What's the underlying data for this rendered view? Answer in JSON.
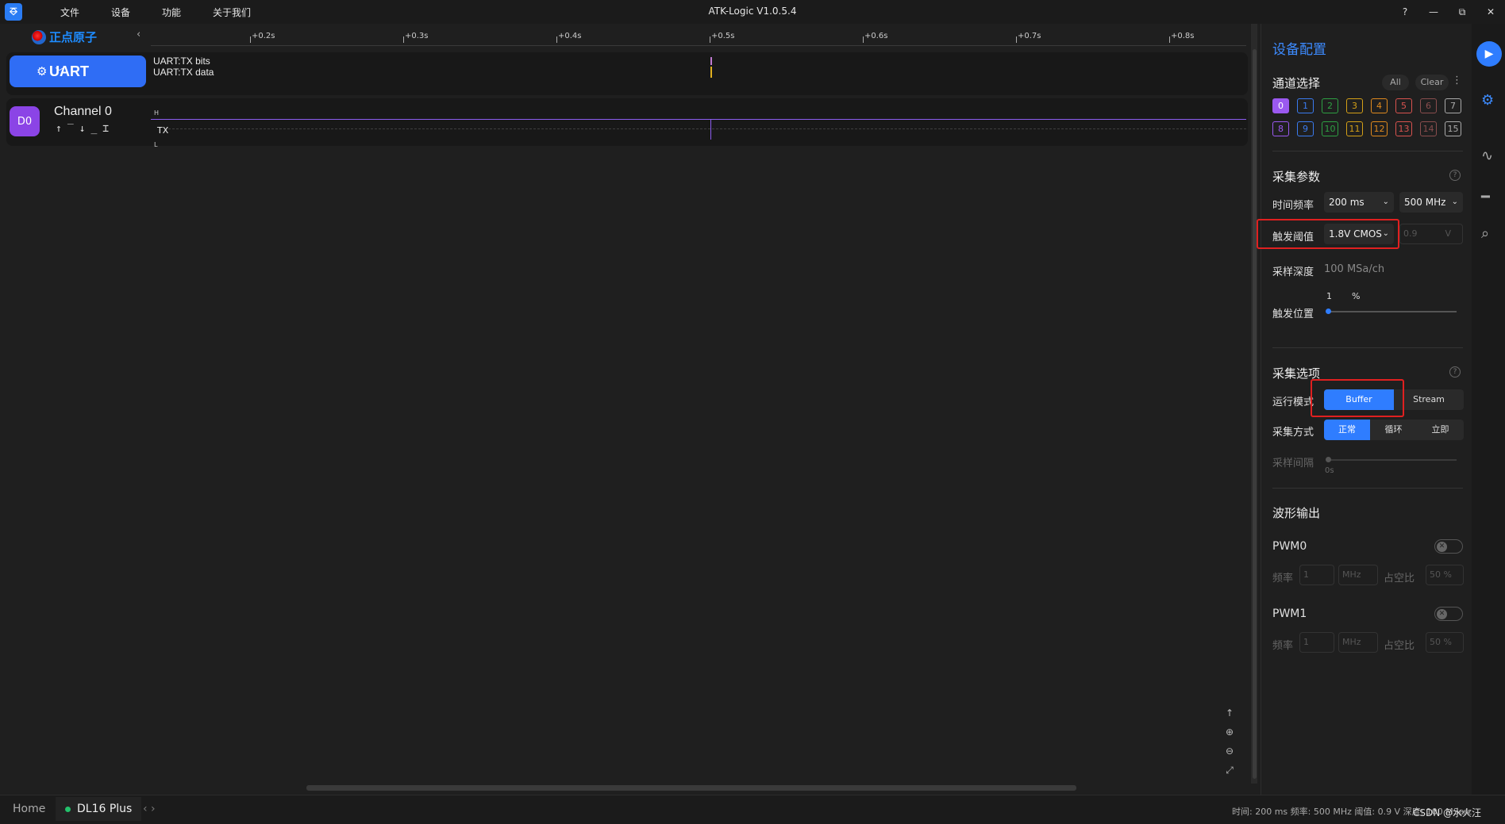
{
  "app": {
    "logo_glyph": "⎑",
    "title": "ATK-Logic  V1.0.5.4"
  },
  "menu": [
    "文件",
    "设备",
    "功能",
    "关于我们"
  ],
  "window_controls": [
    "?",
    "—",
    "⧉",
    "✕"
  ],
  "brand": {
    "text": "正点原子",
    "collapse_glyph": "‹"
  },
  "ruler": {
    "ticks": [
      "+0.2s",
      "+0.3s",
      "+0.4s",
      "+0.5s",
      "+0.6s",
      "+0.7s",
      "+0.8s"
    ]
  },
  "decoder": {
    "name": "UART",
    "gear": "⚙",
    "chevron": "﹀",
    "line1": "UART:TX bits",
    "line2": "UART:TX data"
  },
  "channel": {
    "badge": "D0",
    "name": "Channel 0",
    "trigger_icons": "↑‾↓_⌶",
    "high": "H",
    "low": "L",
    "signal": "TX"
  },
  "zoom_tools": [
    "↑",
    "⊕",
    "⊖",
    "⤢"
  ],
  "panel": {
    "title": "设备配置",
    "channels": {
      "title": "通道选择",
      "all": "All",
      "clear": "Clear",
      "more": "⋮",
      "items": [
        {
          "n": "0",
          "color": "#9b59f0",
          "on": true
        },
        {
          "n": "1",
          "color": "#3a7bf0"
        },
        {
          "n": "2",
          "color": "#2ea043"
        },
        {
          "n": "3",
          "color": "#d4a017"
        },
        {
          "n": "4",
          "color": "#e08a1e"
        },
        {
          "n": "5",
          "color": "#d9534f"
        },
        {
          "n": "6",
          "color": "#8a4e4e"
        },
        {
          "n": "7",
          "color": "#aaaaaa"
        },
        {
          "n": "8",
          "color": "#9b59f0"
        },
        {
          "n": "9",
          "color": "#3a7bf0"
        },
        {
          "n": "10",
          "color": "#2ea043"
        },
        {
          "n": "11",
          "color": "#d4a017"
        },
        {
          "n": "12",
          "color": "#e08a1e"
        },
        {
          "n": "13",
          "color": "#d9534f"
        },
        {
          "n": "14",
          "color": "#8a4e4e"
        },
        {
          "n": "15",
          "color": "#aaaaaa"
        }
      ]
    },
    "params": {
      "title": "采集参数",
      "help": "?",
      "time_label": "时间频率",
      "time_value": "200 ms",
      "freq_value": "500 MHz",
      "threshold_label": "触发阈值",
      "threshold_value": "1.8V CMOS",
      "threshold_volt": "0.9",
      "volt_unit": "V",
      "depth_label": "采样深度",
      "depth_value": "100 MSa/ch",
      "trigger_pos_label": "触发位置",
      "trigger_pos_value": "1",
      "trigger_pos_unit": "%"
    },
    "options": {
      "title": "采集选项",
      "help": "?",
      "run_mode_label": "运行模式",
      "run_modes": [
        "Buffer",
        "Stream"
      ],
      "acq_label": "采集方式",
      "acq_modes": [
        "正常",
        "循环",
        "立即"
      ],
      "interval_label": "采样间隔",
      "interval_value": "0s"
    },
    "output": {
      "title": "波形输出",
      "pwm0": {
        "name": "PWM0",
        "freq_label": "频率",
        "freq": "1",
        "unit": "MHz",
        "duty_label": "占空比",
        "duty": "50 %"
      },
      "pwm1": {
        "name": "PWM1",
        "freq_label": "频率",
        "freq": "1",
        "unit": "MHz",
        "duty_label": "占空比",
        "duty": "50 %"
      }
    }
  },
  "sidebar_icons": [
    "▶",
    "⚙",
    "∿",
    "━",
    "⌕"
  ],
  "status": {
    "home": "Home",
    "device": "DL16 Plus",
    "nav": "‹  ›",
    "info": "时间: 200 ms   频率: 500 MHz   阈值: 0.9 V   深度: 100 MSa/c",
    "watermark": "CSDN @水火汪"
  }
}
